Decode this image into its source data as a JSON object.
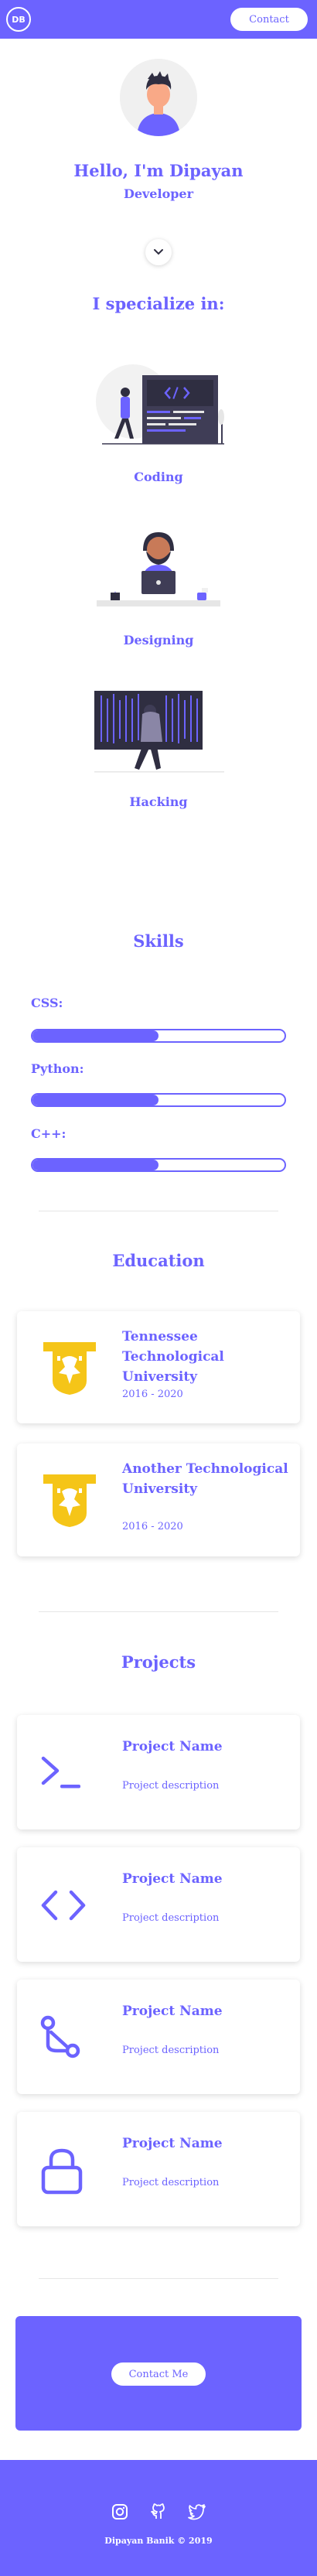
{
  "header": {
    "logo": "DB",
    "contact_label": "Contact"
  },
  "hero": {
    "greeting": "Hello, I'm Dipayan",
    "role": "Developer"
  },
  "specialize": {
    "title": "I specialize in:",
    "items": [
      {
        "label": "Coding"
      },
      {
        "label": "Designing"
      },
      {
        "label": "Hacking"
      }
    ]
  },
  "skills": {
    "title": "Skills",
    "items": [
      {
        "label": "CSS:",
        "level": 0.5
      },
      {
        "label": "Python:",
        "level": 0.5
      },
      {
        "label": "C++:",
        "level": 0.5
      }
    ]
  },
  "education": {
    "title": "Education",
    "items": [
      {
        "name": "Tennessee Technological University",
        "years": "2016 - 2020"
      },
      {
        "name": "Another Technological University",
        "years": "2016 - 2020"
      }
    ]
  },
  "projects": {
    "title": "Projects",
    "items": [
      {
        "icon": "terminal-icon",
        "name": "Project Name",
        "desc": "Project description"
      },
      {
        "icon": "code-icon",
        "name": "Project Name",
        "desc": "Project description"
      },
      {
        "icon": "git-branch-icon",
        "name": "Project Name",
        "desc": "Project description"
      },
      {
        "icon": "lock-icon",
        "name": "Project Name",
        "desc": "Project description"
      }
    ]
  },
  "cta": {
    "button_label": "Contact Me"
  },
  "footer": {
    "socials": [
      "instagram-icon",
      "github-icon",
      "twitter-icon"
    ],
    "copyright": "Dipayan Banik © 2019"
  },
  "colors": {
    "accent": "#6c63ff",
    "gold": "#f5c518",
    "white": "#ffffff"
  }
}
